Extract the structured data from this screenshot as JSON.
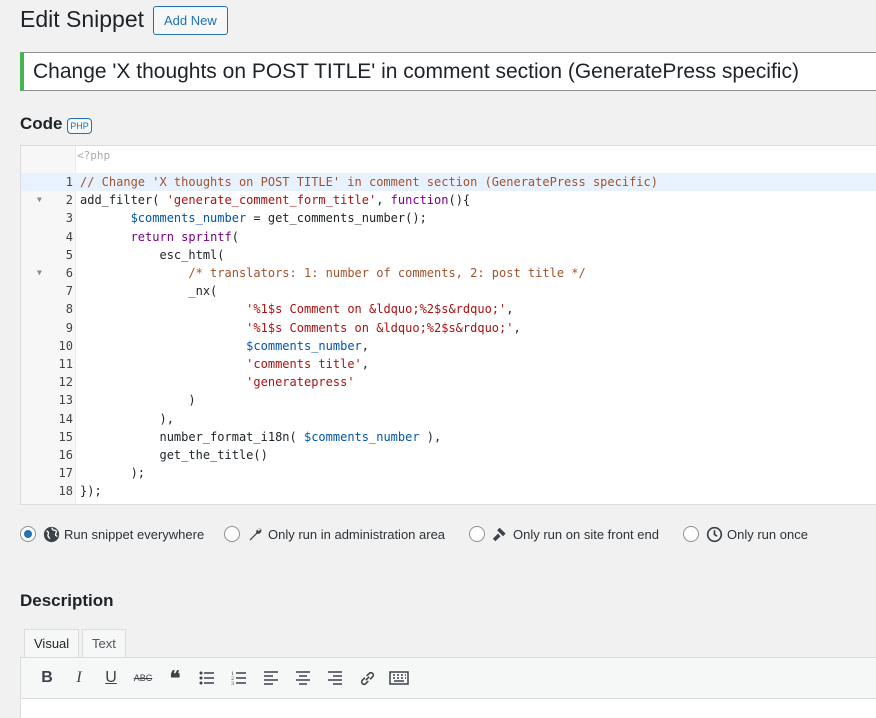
{
  "header": {
    "title": "Edit Snippet",
    "add_new": "Add New"
  },
  "snippet_title": "Change 'X thoughts on POST TITLE' in comment section (GeneratePress specific)",
  "code_section": {
    "heading": "Code",
    "badge": "PHP",
    "php_open_tag": "<?php"
  },
  "colors": {
    "accent": "#2271b1",
    "active_title_border": "#46b450",
    "comment": "#a0522d",
    "string": "#aa1111",
    "variable": "#0055aa"
  },
  "code_lines": [
    {
      "n": "1",
      "fold": false,
      "active": true,
      "tokens": [
        {
          "c": "comment",
          "t": "// Change 'X thoughts on POST TITLE' in comment section (GeneratePress specific)"
        }
      ]
    },
    {
      "n": "2",
      "fold": true,
      "active": false,
      "tokens": [
        {
          "c": "plain",
          "t": "add_filter( "
        },
        {
          "c": "string",
          "t": "'generate_comment_form_title'"
        },
        {
          "c": "plain",
          "t": ", "
        },
        {
          "c": "kw",
          "t": "function"
        },
        {
          "c": "plain",
          "t": "(){"
        }
      ]
    },
    {
      "n": "3",
      "fold": false,
      "active": false,
      "tokens": [
        {
          "c": "plain",
          "t": "       "
        },
        {
          "c": "var",
          "t": "$comments_number"
        },
        {
          "c": "plain",
          "t": " = get_comments_number();"
        }
      ]
    },
    {
      "n": "4",
      "fold": false,
      "active": false,
      "tokens": [
        {
          "c": "plain",
          "t": "       "
        },
        {
          "c": "kw",
          "t": "return"
        },
        {
          "c": "plain",
          "t": " "
        },
        {
          "c": "kw",
          "t": "sprintf"
        },
        {
          "c": "plain",
          "t": "("
        }
      ]
    },
    {
      "n": "5",
      "fold": false,
      "active": false,
      "tokens": [
        {
          "c": "plain",
          "t": "           esc_html("
        }
      ]
    },
    {
      "n": "6",
      "fold": true,
      "active": false,
      "tokens": [
        {
          "c": "plain",
          "t": "               "
        },
        {
          "c": "comment",
          "t": "/* translators: 1: number of comments, 2: post title */"
        }
      ]
    },
    {
      "n": "7",
      "fold": false,
      "active": false,
      "tokens": [
        {
          "c": "plain",
          "t": "               _nx("
        }
      ]
    },
    {
      "n": "8",
      "fold": false,
      "active": false,
      "tokens": [
        {
          "c": "plain",
          "t": "                       "
        },
        {
          "c": "string",
          "t": "'%1$s Comment on &ldquo;%2$s&rdquo;'"
        },
        {
          "c": "plain",
          "t": ","
        }
      ]
    },
    {
      "n": "9",
      "fold": false,
      "active": false,
      "tokens": [
        {
          "c": "plain",
          "t": "                       "
        },
        {
          "c": "string",
          "t": "'%1$s Comments on &ldquo;%2$s&rdquo;'"
        },
        {
          "c": "plain",
          "t": ","
        }
      ]
    },
    {
      "n": "10",
      "fold": false,
      "active": false,
      "tokens": [
        {
          "c": "plain",
          "t": "                       "
        },
        {
          "c": "var",
          "t": "$comments_number"
        },
        {
          "c": "plain",
          "t": ","
        }
      ]
    },
    {
      "n": "11",
      "fold": false,
      "active": false,
      "tokens": [
        {
          "c": "plain",
          "t": "                       "
        },
        {
          "c": "string",
          "t": "'comments title'"
        },
        {
          "c": "plain",
          "t": ","
        }
      ]
    },
    {
      "n": "12",
      "fold": false,
      "active": false,
      "tokens": [
        {
          "c": "plain",
          "t": "                       "
        },
        {
          "c": "string",
          "t": "'generatepress'"
        }
      ]
    },
    {
      "n": "13",
      "fold": false,
      "active": false,
      "tokens": [
        {
          "c": "plain",
          "t": "               )"
        }
      ]
    },
    {
      "n": "14",
      "fold": false,
      "active": false,
      "tokens": [
        {
          "c": "plain",
          "t": "           ),"
        }
      ]
    },
    {
      "n": "15",
      "fold": false,
      "active": false,
      "tokens": [
        {
          "c": "plain",
          "t": "           number_format_i18n( "
        },
        {
          "c": "var",
          "t": "$comments_number"
        },
        {
          "c": "plain",
          "t": " ),"
        }
      ]
    },
    {
      "n": "16",
      "fold": false,
      "active": false,
      "tokens": [
        {
          "c": "plain",
          "t": "           get_the_title()"
        }
      ]
    },
    {
      "n": "17",
      "fold": false,
      "active": false,
      "tokens": [
        {
          "c": "plain",
          "t": "       );"
        }
      ]
    },
    {
      "n": "18",
      "fold": false,
      "active": false,
      "tokens": [
        {
          "c": "plain",
          "t": "});"
        }
      ]
    }
  ],
  "scope_options": [
    {
      "label": "Run snippet everywhere",
      "icon": "globe-icon",
      "checked": true
    },
    {
      "label": "Only run in administration area",
      "icon": "wrench-icon",
      "checked": false
    },
    {
      "label": "Only run on site front end",
      "icon": "hammer-icon",
      "checked": false
    },
    {
      "label": "Only run once",
      "icon": "clock-icon",
      "checked": false
    }
  ],
  "description": {
    "heading": "Description",
    "tab_visual": "Visual",
    "tab_text": "Text"
  },
  "toolbar_buttons": [
    {
      "name": "bold-icon",
      "glyph": "B"
    },
    {
      "name": "italic-icon",
      "glyph": "I"
    },
    {
      "name": "underline-icon",
      "glyph": "U"
    },
    {
      "name": "strikethrough-icon",
      "glyph": "ABC"
    },
    {
      "name": "blockquote-icon",
      "glyph": "❝"
    },
    {
      "name": "bullet-list-icon",
      "glyph": ""
    },
    {
      "name": "numbered-list-icon",
      "glyph": ""
    },
    {
      "name": "align-left-icon",
      "glyph": ""
    },
    {
      "name": "align-center-icon",
      "glyph": ""
    },
    {
      "name": "align-right-icon",
      "glyph": ""
    },
    {
      "name": "link-icon",
      "glyph": ""
    },
    {
      "name": "keyboard-icon",
      "glyph": ""
    }
  ]
}
